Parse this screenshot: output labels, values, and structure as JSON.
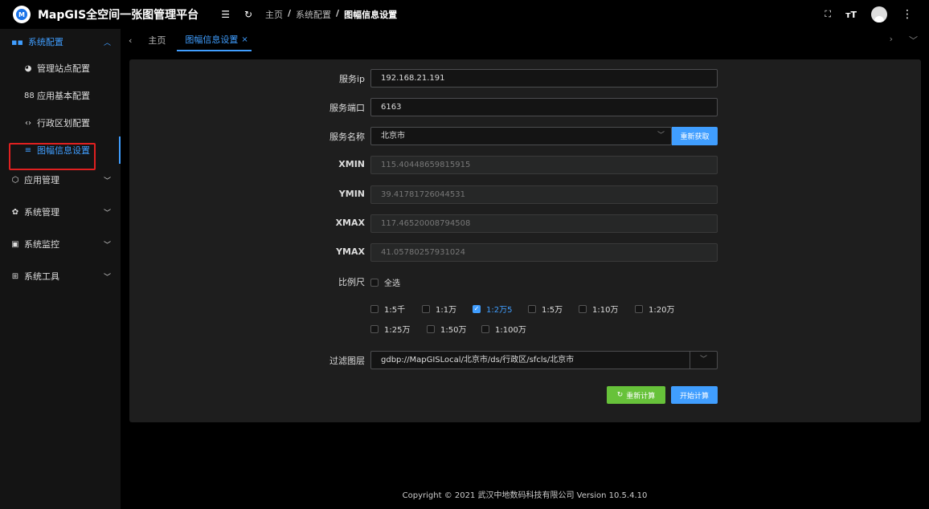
{
  "app": {
    "title": "MapGIS全空间一张图管理平台"
  },
  "breadcrumb": [
    "主页",
    "系统配置",
    "图幅信息设置"
  ],
  "sidebar": {
    "header": "系统配置",
    "items": [
      {
        "label": "管理站点配置",
        "icon": "globe-icon"
      },
      {
        "label": "应用基本配置",
        "icon": "grid-icon"
      },
      {
        "label": "行政区划配置",
        "icon": "code-icon"
      },
      {
        "label": "图幅信息设置",
        "icon": "menu-icon",
        "active": true
      }
    ],
    "groups": [
      {
        "label": "应用管理",
        "icon": "box-icon"
      },
      {
        "label": "系统管理",
        "icon": "gear-icon"
      },
      {
        "label": "系统监控",
        "icon": "monitor-icon"
      },
      {
        "label": "系统工具",
        "icon": "toolbox-icon"
      }
    ]
  },
  "tabs": [
    {
      "label": "主页"
    },
    {
      "label": "图幅信息设置",
      "active": true
    }
  ],
  "form": {
    "service_ip": {
      "label": "服务ip",
      "value": "192.168.21.191"
    },
    "service_port": {
      "label": "服务端口",
      "value": "6163"
    },
    "service_name": {
      "label": "服务名称",
      "value": "北京市",
      "refetch": "重新获取"
    },
    "xmin": {
      "label": "XMIN",
      "value": "115.40448659815915"
    },
    "ymin": {
      "label": "YMIN",
      "value": "39.41781726044531"
    },
    "xmax": {
      "label": "XMAX",
      "value": "117.46520008794508"
    },
    "ymax": {
      "label": "YMAX",
      "value": "41.05780257931024"
    },
    "scale": {
      "label": "比例尺",
      "select_all": "全选",
      "options": [
        {
          "label": "1:5千",
          "checked": false
        },
        {
          "label": "1:1万",
          "checked": false
        },
        {
          "label": "1:2万5",
          "checked": true
        },
        {
          "label": "1:5万",
          "checked": false
        },
        {
          "label": "1:10万",
          "checked": false
        },
        {
          "label": "1:20万",
          "checked": false
        },
        {
          "label": "1:25万",
          "checked": false
        },
        {
          "label": "1:50万",
          "checked": false
        },
        {
          "label": "1:100万",
          "checked": false
        }
      ]
    },
    "filter_layer": {
      "label": "过滤图层",
      "value": "gdbp://MapGISLocal/北京市/ds/行政区/sfcls/北京市"
    },
    "recalc_button": "重新计算",
    "start_button": "开始计算"
  },
  "footer": "Copyright © 2021 武汉中地数码科技有限公司 Version 10.5.4.10",
  "colors": {
    "accent": "#409eff",
    "success": "#67c23a",
    "background": "#000000",
    "panel": "#1e1e1e"
  }
}
